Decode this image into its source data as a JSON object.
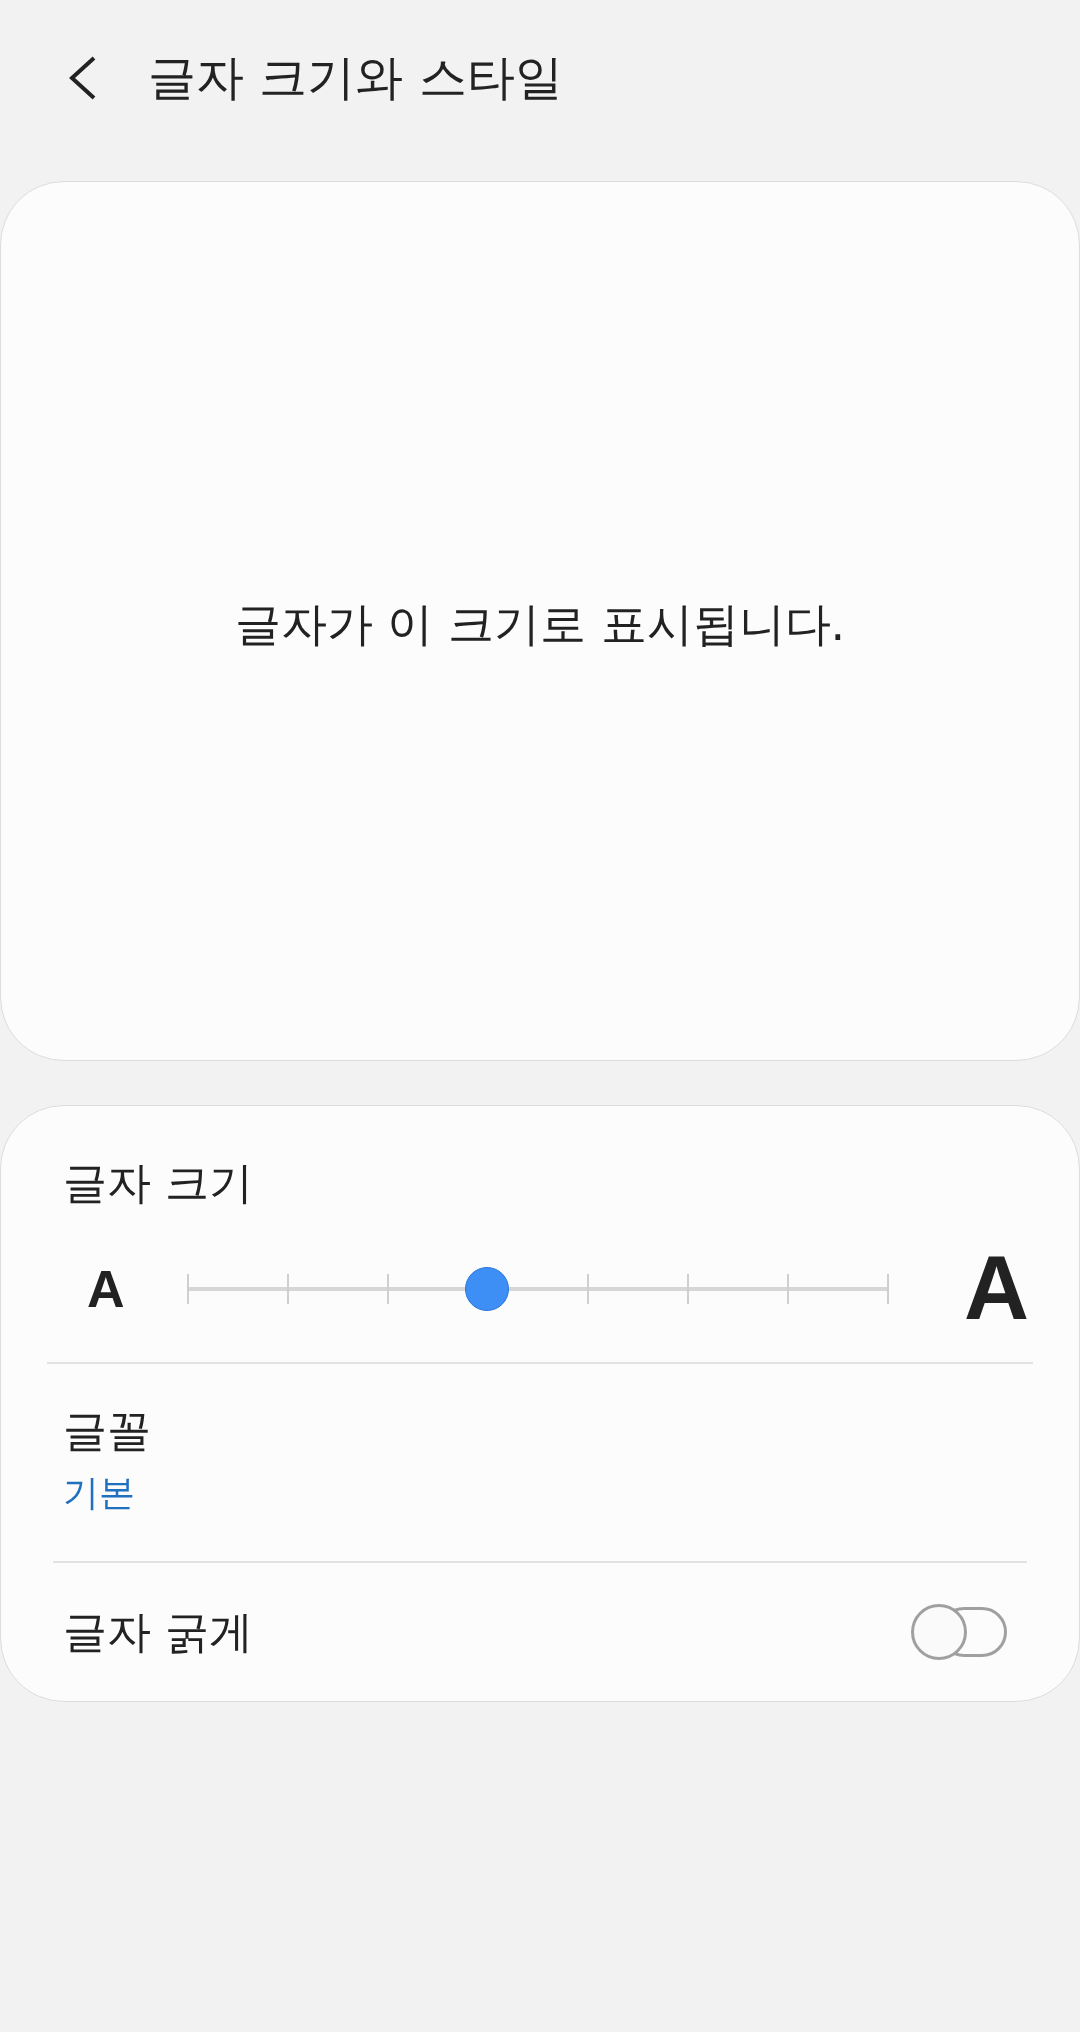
{
  "header": {
    "title": "글자 크기와 스타일"
  },
  "preview": {
    "text": "글자가 이 크기로 표시됩니다."
  },
  "settings": {
    "font_size": {
      "label": "글자 크기",
      "small_glyph": "A",
      "large_glyph": "A",
      "level": 0.4286
    },
    "font": {
      "label": "글꼴",
      "value": "기본"
    },
    "bold": {
      "label": "글자 굵게",
      "on": false
    }
  }
}
